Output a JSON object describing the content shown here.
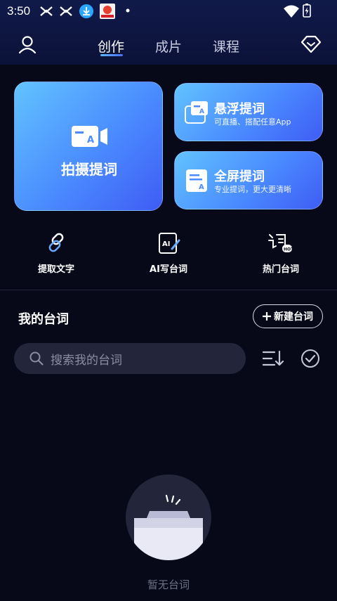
{
  "status_bar": {
    "time": "3:50"
  },
  "nav": {
    "tabs": [
      {
        "label": "创作"
      },
      {
        "label": "成片"
      },
      {
        "label": "课程"
      }
    ]
  },
  "cards": {
    "camera": {
      "title": "拍摄提词"
    },
    "floating": {
      "title": "悬浮提词",
      "subtitle": "可直播、搭配任意App"
    },
    "fullscreen": {
      "title": "全屏提词",
      "subtitle": "专业提词，更大更清晰"
    }
  },
  "tools": [
    {
      "label": "提取文字"
    },
    {
      "label": "AI写台词"
    },
    {
      "label": "热门台词"
    }
  ],
  "scripts": {
    "title": "我的台词",
    "new_label": "新建台词",
    "search_placeholder": "搜索我的台词",
    "empty_text": "暂无台词"
  },
  "colors": {
    "accent": "#4c6dff",
    "card_light": "#62c3ff",
    "card_dark": "#3f5cf4",
    "background": "#070918"
  }
}
